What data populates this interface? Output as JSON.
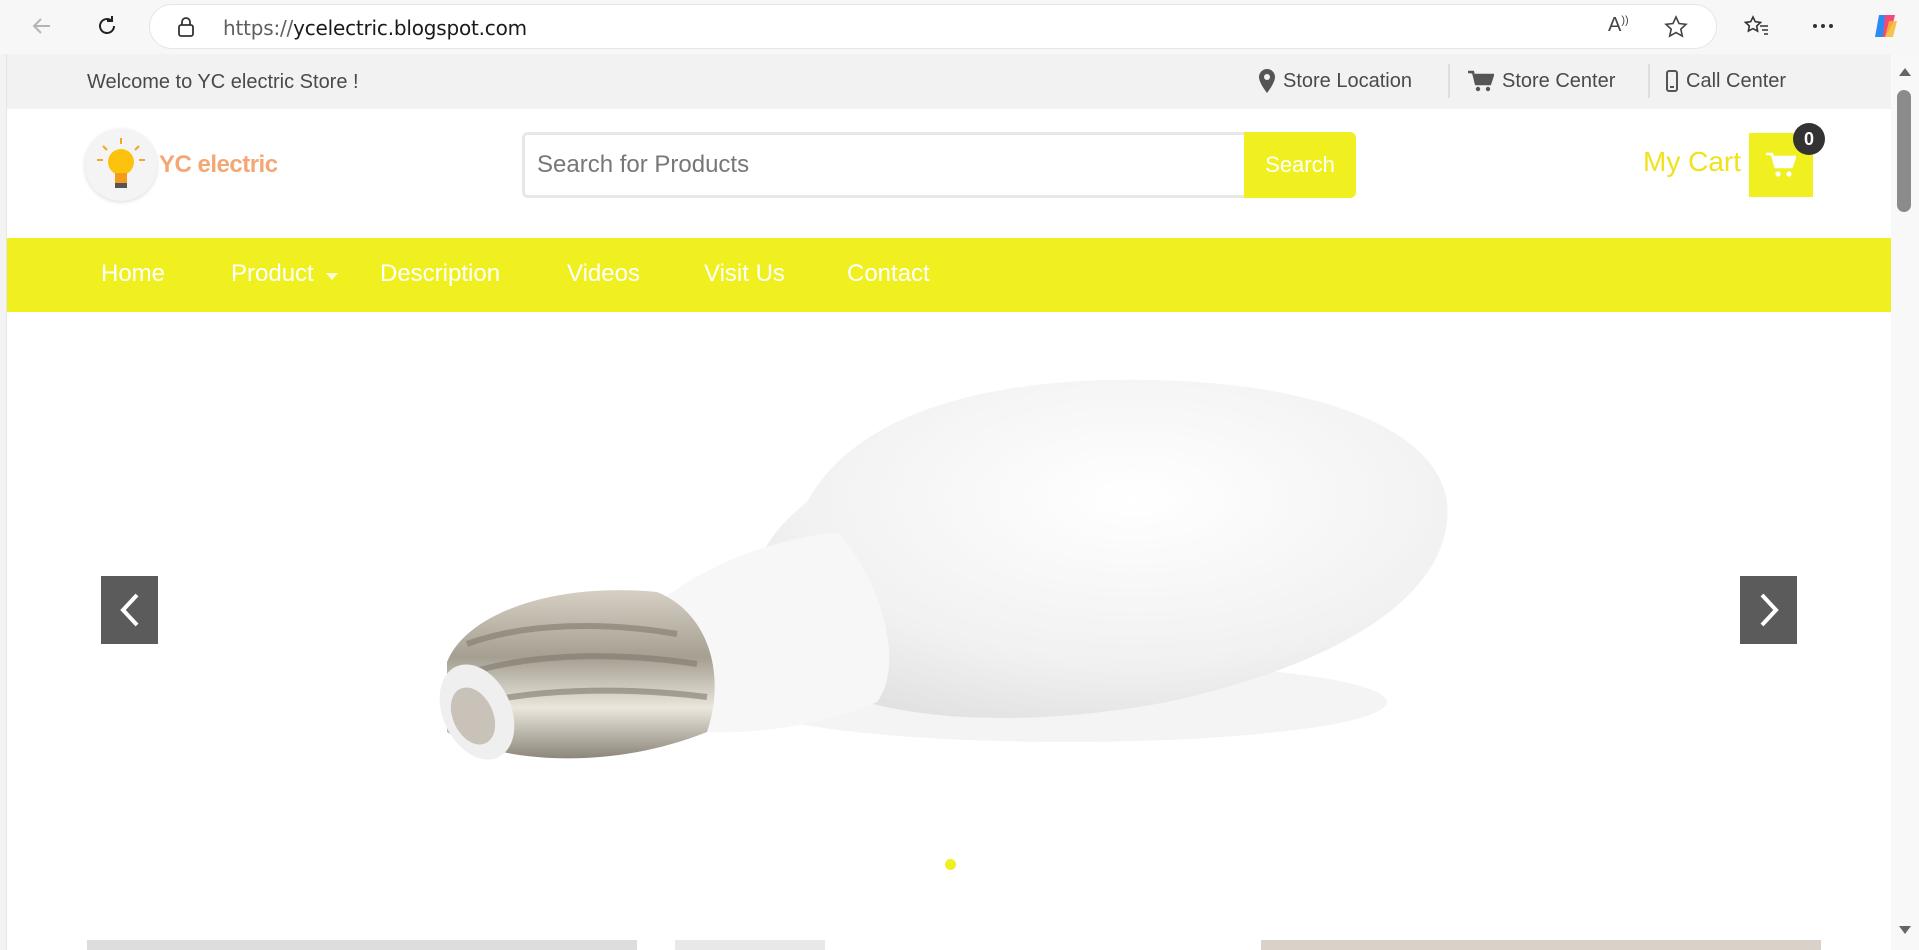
{
  "browser": {
    "url_protocol": "https://",
    "url_host": "ycelectric.blogspot.com"
  },
  "topbar": {
    "welcome": "Welcome to YC electric Store !",
    "links": [
      {
        "label": "Store Location",
        "icon": "map-pin-icon"
      },
      {
        "label": "Store Center",
        "icon": "cart-icon"
      },
      {
        "label": "Call Center",
        "icon": "mobile-phone-icon"
      }
    ]
  },
  "header": {
    "logo_text": "YC electric",
    "search_placeholder": "Search for Products",
    "search_button": "Search",
    "cart_label": "My Cart",
    "cart_count": "0"
  },
  "menu": {
    "items": [
      "Home",
      "Product",
      "Description",
      "Videos",
      "Visit Us",
      "Contact"
    ]
  },
  "colors": {
    "accent_yellow": "#f0ef1f",
    "logo_orange": "#f4a775",
    "arrow_gray": "#5b5b5b"
  }
}
